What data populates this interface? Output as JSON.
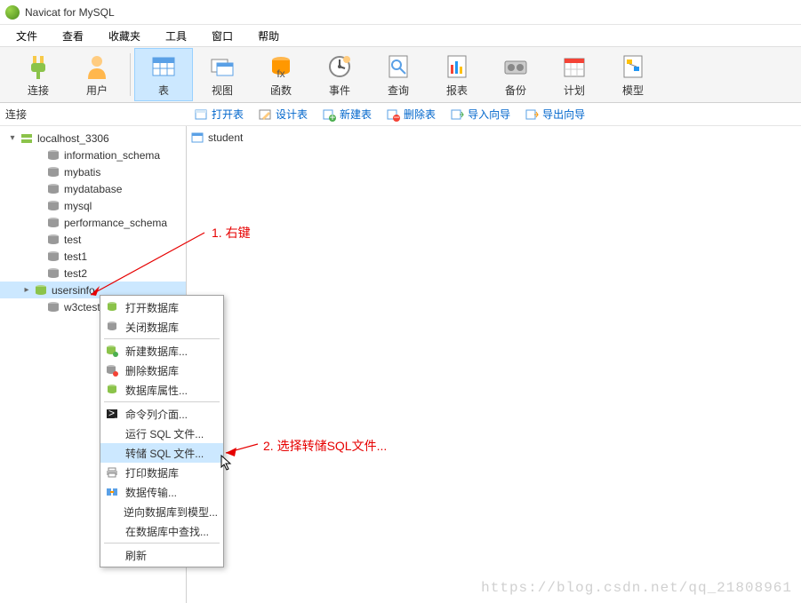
{
  "title": "Navicat for MySQL",
  "menu": [
    "文件",
    "查看",
    "收藏夹",
    "工具",
    "窗口",
    "帮助"
  ],
  "toolbar": [
    {
      "label": "连接",
      "icon": "plug",
      "active": false
    },
    {
      "label": "用户",
      "icon": "user",
      "active": false
    },
    {
      "label": "表",
      "icon": "table",
      "active": true
    },
    {
      "label": "视图",
      "icon": "view",
      "active": false
    },
    {
      "label": "函数",
      "icon": "function",
      "active": false
    },
    {
      "label": "事件",
      "icon": "event",
      "active": false
    },
    {
      "label": "查询",
      "icon": "query",
      "active": false
    },
    {
      "label": "报表",
      "icon": "report",
      "active": false
    },
    {
      "label": "备份",
      "icon": "backup",
      "active": false
    },
    {
      "label": "计划",
      "icon": "schedule",
      "active": false
    },
    {
      "label": "模型",
      "icon": "model",
      "active": false
    }
  ],
  "sub_toolbar": {
    "left_label": "连接",
    "items": [
      {
        "label": "打开表",
        "icon": "open"
      },
      {
        "label": "设计表",
        "icon": "design"
      },
      {
        "label": "新建表",
        "icon": "new"
      },
      {
        "label": "删除表",
        "icon": "delete"
      },
      {
        "label": "导入向导",
        "icon": "import"
      },
      {
        "label": "导出向导",
        "icon": "export"
      }
    ]
  },
  "tree": {
    "root": {
      "label": "localhost_3306",
      "icon": "server",
      "expanded": true
    },
    "children": [
      {
        "label": "information_schema",
        "icon": "db"
      },
      {
        "label": "mybatis",
        "icon": "db"
      },
      {
        "label": "mydatabase",
        "icon": "db"
      },
      {
        "label": "mysql",
        "icon": "db"
      },
      {
        "label": "performance_schema",
        "icon": "db"
      },
      {
        "label": "test",
        "icon": "db"
      },
      {
        "label": "test1",
        "icon": "db"
      },
      {
        "label": "test2",
        "icon": "db"
      },
      {
        "label": "usersinfo",
        "icon": "db-open",
        "selected": true,
        "expandable": true
      },
      {
        "label": "w3ctest",
        "icon": "db"
      }
    ]
  },
  "content": {
    "items": [
      {
        "label": "student",
        "icon": "table"
      }
    ]
  },
  "context_menu": [
    {
      "label": "打开数据库",
      "icon": "db-open"
    },
    {
      "label": "关闭数据库",
      "icon": "db"
    },
    {
      "sep": true
    },
    {
      "label": "新建数据库...",
      "icon": "db-new"
    },
    {
      "label": "删除数据库",
      "icon": "db-del"
    },
    {
      "label": "数据库属性...",
      "icon": "db-prop"
    },
    {
      "sep": true
    },
    {
      "label": "命令列介面...",
      "icon": "cmd"
    },
    {
      "label": "运行 SQL 文件...",
      "icon": ""
    },
    {
      "label": "转储 SQL 文件...",
      "icon": "",
      "highlight": true
    },
    {
      "label": "打印数据库",
      "icon": "print"
    },
    {
      "label": "数据传输...",
      "icon": "transfer"
    },
    {
      "label": "逆向数据库到模型...",
      "icon": ""
    },
    {
      "label": "在数据库中查找...",
      "icon": ""
    },
    {
      "sep": true
    },
    {
      "label": "刷新",
      "icon": ""
    }
  ],
  "annotations": {
    "a1": "1. 右键",
    "a2": "2. 选择转储SQL文件..."
  },
  "watermark": "https://blog.csdn.net/qq_21808961"
}
